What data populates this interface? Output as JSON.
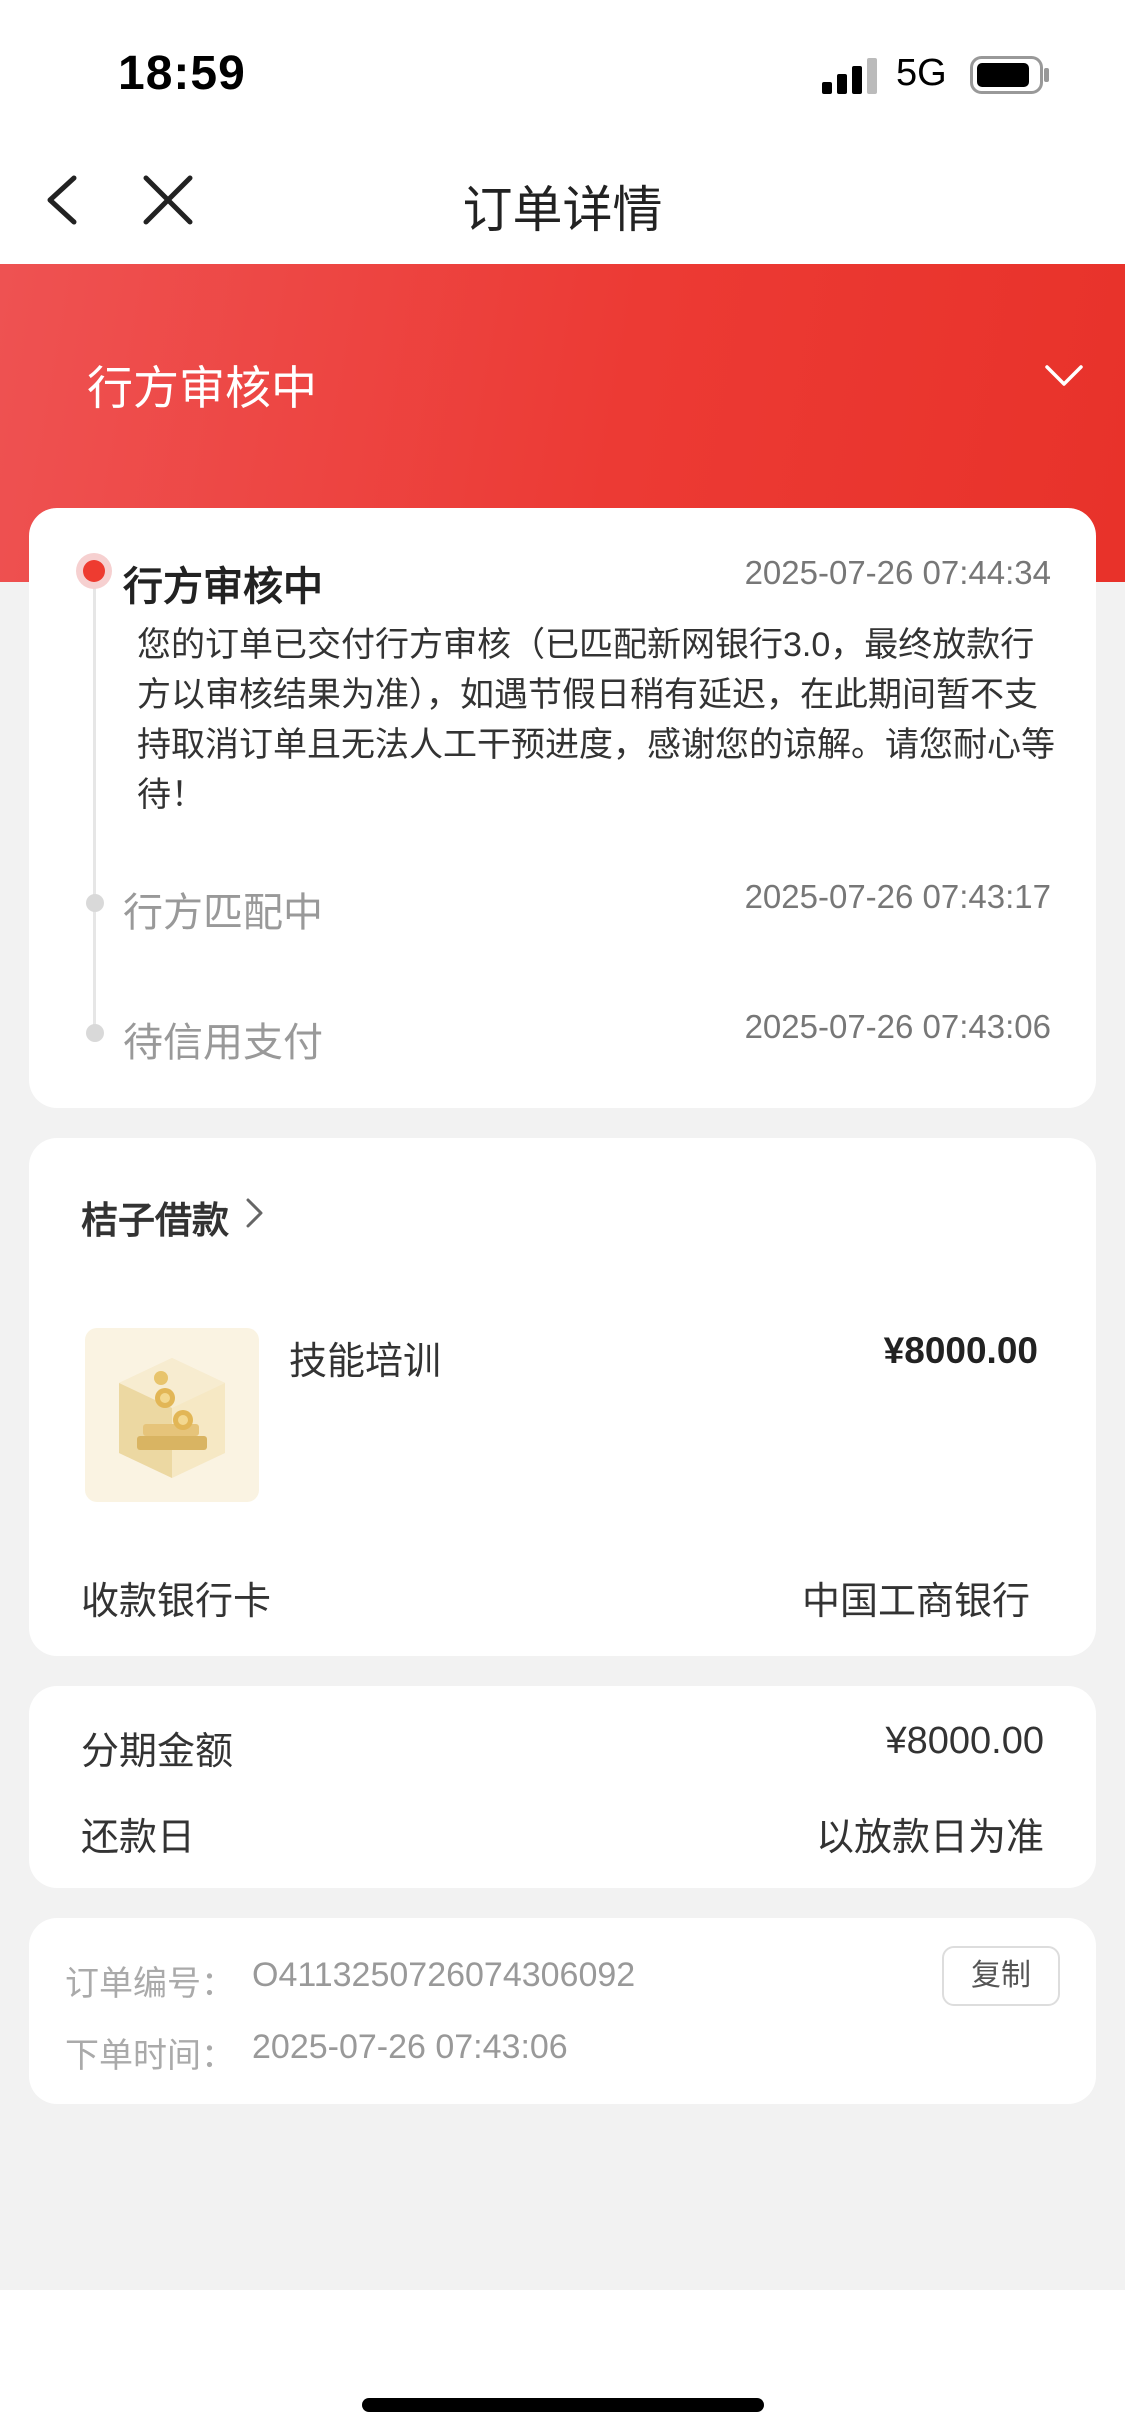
{
  "status_bar": {
    "time": "18:59",
    "network": "5G",
    "signal_icon": "signal-bars-icon",
    "battery_icon": "battery-icon"
  },
  "nav": {
    "title": "订单详情",
    "back_icon": "chevron-left-icon",
    "close_icon": "close-icon"
  },
  "banner": {
    "status": "行方审核中",
    "expand_icon": "chevron-down-icon",
    "color_start": "#ee5252",
    "color_end": "#e8322a"
  },
  "timeline": {
    "items": [
      {
        "title": "行方审核中",
        "time": "2025-07-26 07:44:34",
        "description": "您的订单已交付行方审核（已匹配新网银行3.0，最终放款行方以审核结果为准），如遇节假日稍有延迟，在此期间暂不支持取消订单且无法人工干预进度，感谢您的谅解。请您耐心等待！"
      },
      {
        "title": "行方匹配中",
        "time": "2025-07-26 07:43:17"
      },
      {
        "title": "待信用支付",
        "time": "2025-07-26 07:43:06"
      }
    ],
    "active_color": "#ee3b30"
  },
  "product": {
    "merchant": "桔子借款",
    "item_name": "技能培训",
    "price": "¥8000.00",
    "thumbnail_icon": "coin-box-icon",
    "bank_label": "收款银行卡",
    "bank_value": "中国工商银行"
  },
  "installment": {
    "amount_label": "分期金额",
    "amount_value": "¥8000.00",
    "repay_label": "还款日",
    "repay_value": "以放款日为准"
  },
  "order": {
    "number_label": "订单编号：",
    "number_value": "O4113250726074306092",
    "copy_label": "复制",
    "time_label": "下单时间：",
    "time_value": "2025-07-26 07:43:06"
  }
}
